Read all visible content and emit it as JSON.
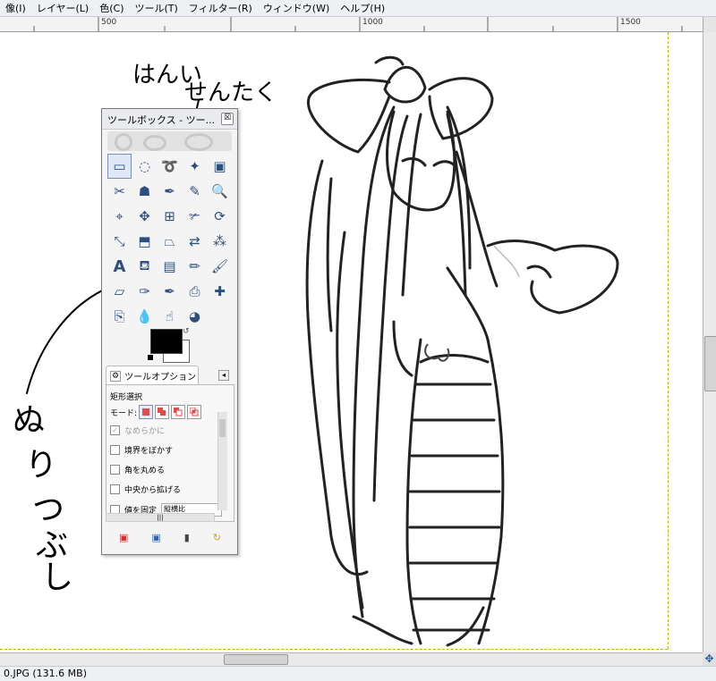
{
  "menubar": {
    "items": [
      "像(I)",
      "レイヤー(L)",
      "色(C)",
      "ツール(T)",
      "フィルター(R)",
      "ウィンドウ(W)",
      "ヘルプ(H)"
    ]
  },
  "ruler": {
    "ticks": [
      "500",
      "1000",
      "1500"
    ]
  },
  "toolbox": {
    "title": "ツールボックス - ツー...",
    "close_glyph": "☒",
    "tools": [
      {
        "name": "rect-select-icon",
        "glyph": "▭"
      },
      {
        "name": "ellipse-select-icon",
        "glyph": "◌"
      },
      {
        "name": "free-select-icon",
        "glyph": "➰"
      },
      {
        "name": "fuzzy-select-icon",
        "glyph": "✦"
      },
      {
        "name": "select-by-color-icon",
        "glyph": "▣"
      },
      {
        "name": "scissors-select-icon",
        "glyph": "✂"
      },
      {
        "name": "foreground-select-icon",
        "glyph": "☗"
      },
      {
        "name": "paths-icon",
        "glyph": "✒"
      },
      {
        "name": "color-picker-icon",
        "glyph": "✎"
      },
      {
        "name": "zoom-icon",
        "glyph": "🔍"
      },
      {
        "name": "measure-icon",
        "glyph": "⌖"
      },
      {
        "name": "move-icon",
        "glyph": "✥"
      },
      {
        "name": "align-icon",
        "glyph": "⊞"
      },
      {
        "name": "crop-icon",
        "glyph": "✃"
      },
      {
        "name": "rotate-icon",
        "glyph": "⟳"
      },
      {
        "name": "scale-icon",
        "glyph": "⤡"
      },
      {
        "name": "shear-icon",
        "glyph": "⬒"
      },
      {
        "name": "perspective-icon",
        "glyph": "⏢"
      },
      {
        "name": "flip-icon",
        "glyph": "⇄"
      },
      {
        "name": "cage-transform-icon",
        "glyph": "⁂"
      },
      {
        "name": "text-icon",
        "glyph": "A"
      },
      {
        "name": "bucket-fill-icon",
        "glyph": "⛾"
      },
      {
        "name": "blend-icon",
        "glyph": "▤"
      },
      {
        "name": "pencil-icon",
        "glyph": "✏"
      },
      {
        "name": "paintbrush-icon",
        "glyph": "🖌"
      },
      {
        "name": "eraser-icon",
        "glyph": "▱"
      },
      {
        "name": "airbrush-icon",
        "glyph": "✑"
      },
      {
        "name": "ink-icon",
        "glyph": "✒"
      },
      {
        "name": "clone-icon",
        "glyph": "⎙"
      },
      {
        "name": "heal-icon",
        "glyph": "✚"
      },
      {
        "name": "perspective-clone-icon",
        "glyph": "⎘"
      },
      {
        "name": "blur-icon",
        "glyph": "💧"
      },
      {
        "name": "smudge-icon",
        "glyph": "☝"
      },
      {
        "name": "dodge-burn-icon",
        "glyph": "◕"
      }
    ],
    "options_tab": "ツールオプション",
    "options_heading": "矩形選択",
    "mode_label": "モード:",
    "options": [
      {
        "label": "なめらかに",
        "checked": true,
        "disabled": true
      },
      {
        "label": "境界をぼかす",
        "checked": false,
        "disabled": false
      },
      {
        "label": "角を丸める",
        "checked": false,
        "disabled": false
      },
      {
        "label": "中央から拡げる",
        "checked": false,
        "disabled": false
      },
      {
        "label": "値を固定",
        "checked": false,
        "disabled": false
      }
    ],
    "fixed_ratio_value": "縦横比"
  },
  "status": {
    "text": "0.JPG (131.6 MB)"
  },
  "annotations": {
    "top_line1": "はんい",
    "top_line2": "せんたく",
    "left_vertical": [
      "ぬ",
      "り",
      "つ",
      "ぶ",
      "し"
    ]
  },
  "colors": {
    "accent": "#7a90b2",
    "guide": "#c8b400",
    "foreground": "#000000",
    "background": "#ffffff"
  }
}
